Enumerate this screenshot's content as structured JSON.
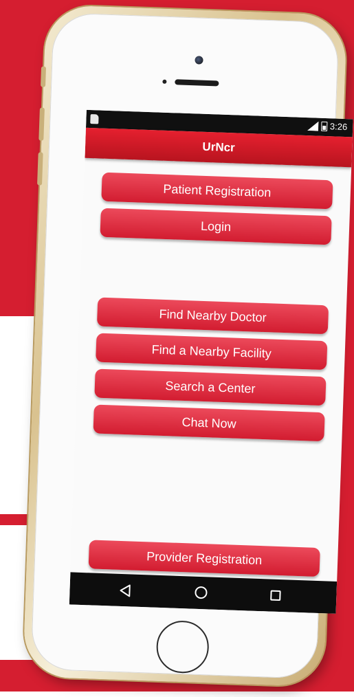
{
  "status_bar": {
    "time": "3:26",
    "icons": [
      "sim-card-icon",
      "signal-icon",
      "battery-icon"
    ]
  },
  "app_bar": {
    "title": "UrNcr"
  },
  "buttons": {
    "patient_registration": "Patient Registration",
    "login": "Login",
    "find_nearby_doctor": "Find Nearby Doctor",
    "find_nearby_facility": "Find a Nearby Facility",
    "search_center": "Search a Center",
    "chat_now": "Chat Now",
    "provider_registration": "Provider Registration"
  },
  "nav_bar": {
    "icons": [
      "back-icon",
      "home-icon",
      "recent-apps-icon"
    ]
  },
  "colors": {
    "brand_red": "#d51e30",
    "button_red": "#e03244",
    "app_bar_red": "#d11a27",
    "screen_background": "#fafafa"
  }
}
